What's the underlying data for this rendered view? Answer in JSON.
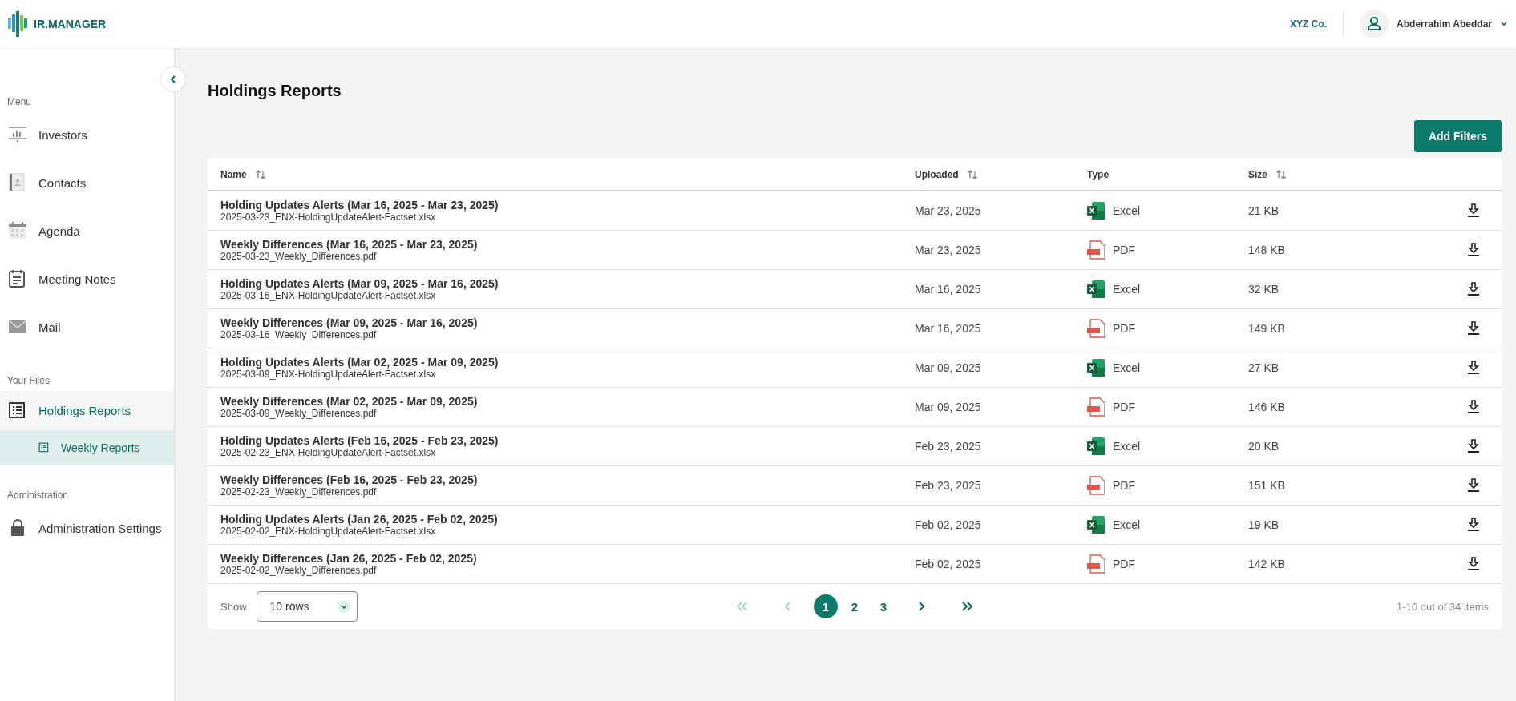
{
  "header": {
    "logo_text": "IR.MANAGER",
    "company": "XYZ Co.",
    "user": "Abderrahim Abeddar"
  },
  "sidebar": {
    "sections": [
      {
        "title": "Menu",
        "items": [
          {
            "label": "Investors",
            "selected": false
          },
          {
            "label": "Contacts",
            "selected": false
          },
          {
            "label": "Agenda",
            "selected": false
          },
          {
            "label": "Meeting Notes",
            "selected": false
          },
          {
            "label": "Mail",
            "selected": false
          }
        ]
      },
      {
        "title": "Your Files",
        "items": [
          {
            "label": "Holdings Reports",
            "selected": true,
            "children": [
              {
                "label": "Weekly Reports",
                "selected": true
              }
            ]
          }
        ]
      },
      {
        "title": "Administration",
        "items": [
          {
            "label": "Administration Settings",
            "selected": false
          }
        ]
      }
    ]
  },
  "page": {
    "title": "Holdings Reports",
    "add_filters": "Add Filters"
  },
  "table": {
    "columns": [
      {
        "label": "Name",
        "sortable": true
      },
      {
        "label": "Uploaded",
        "sortable": true
      },
      {
        "label": "Type",
        "sortable": false
      },
      {
        "label": "Size",
        "sortable": true
      }
    ],
    "rows": [
      {
        "title": "Holding Updates Alerts (Mar 16, 2025 - Mar 23, 2025)",
        "file": "2025-03-23_ENX-HoldingUpdateAlert-Factset.xlsx",
        "uploaded": "Mar 23, 2025",
        "kind": "excel",
        "type": "Excel",
        "size": "21 KB"
      },
      {
        "title": "Weekly Differences (Mar 16, 2025 - Mar 23, 2025)",
        "file": "2025-03-23_Weekly_Differences.pdf",
        "uploaded": "Mar 23, 2025",
        "kind": "pdf",
        "type": "PDF",
        "size": "148 KB"
      },
      {
        "title": "Holding Updates Alerts (Mar 09, 2025 - Mar 16, 2025)",
        "file": "2025-03-16_ENX-HoldingUpdateAlert-Factset.xlsx",
        "uploaded": "Mar 16, 2025",
        "kind": "excel",
        "type": "Excel",
        "size": "32 KB"
      },
      {
        "title": "Weekly Differences (Mar 09, 2025 - Mar 16, 2025)",
        "file": "2025-03-16_Weekly_Differences.pdf",
        "uploaded": "Mar 16, 2025",
        "kind": "pdf",
        "type": "PDF",
        "size": "149 KB"
      },
      {
        "title": "Holding Updates Alerts (Mar 02, 2025 - Mar 09, 2025)",
        "file": "2025-03-09_ENX-HoldingUpdateAlert-Factset.xlsx",
        "uploaded": "Mar 09, 2025",
        "kind": "excel",
        "type": "Excel",
        "size": "27 KB"
      },
      {
        "title": "Weekly Differences (Mar 02, 2025 - Mar 09, 2025)",
        "file": "2025-03-09_Weekly_Differences.pdf",
        "uploaded": "Mar 09, 2025",
        "kind": "pdf",
        "type": "PDF",
        "size": "146 KB"
      },
      {
        "title": "Holding Updates Alerts (Feb 16, 2025 - Feb 23, 2025)",
        "file": "2025-02-23_ENX-HoldingUpdateAlert-Factset.xlsx",
        "uploaded": "Feb 23, 2025",
        "kind": "excel",
        "type": "Excel",
        "size": "20 KB"
      },
      {
        "title": "Weekly Differences (Feb 16, 2025 - Feb 23, 2025)",
        "file": "2025-02-23_Weekly_Differences.pdf",
        "uploaded": "Feb 23, 2025",
        "kind": "pdf",
        "type": "PDF",
        "size": "151 KB"
      },
      {
        "title": "Holding Updates Alerts (Jan 26, 2025 - Feb 02, 2025)",
        "file": "2025-02-02_ENX-HoldingUpdateAlert-Factset.xlsx",
        "uploaded": "Feb 02, 2025",
        "kind": "excel",
        "type": "Excel",
        "size": "19 KB"
      },
      {
        "title": "Weekly Differences (Jan 26, 2025 - Feb 02, 2025)",
        "file": "2025-02-02_Weekly_Differences.pdf",
        "uploaded": "Feb 02, 2025",
        "kind": "pdf",
        "type": "PDF",
        "size": "142 KB"
      }
    ]
  },
  "pagination": {
    "show_label": "Show",
    "rows_value": "10 rows",
    "first_disabled": true,
    "prev_disabled": true,
    "next_disabled": false,
    "last_disabled": false,
    "pages": [
      {
        "label": "1",
        "selected": true
      },
      {
        "label": "2",
        "selected": false
      },
      {
        "label": "3",
        "selected": false
      }
    ],
    "summary": "1-10 out of 34 items"
  }
}
